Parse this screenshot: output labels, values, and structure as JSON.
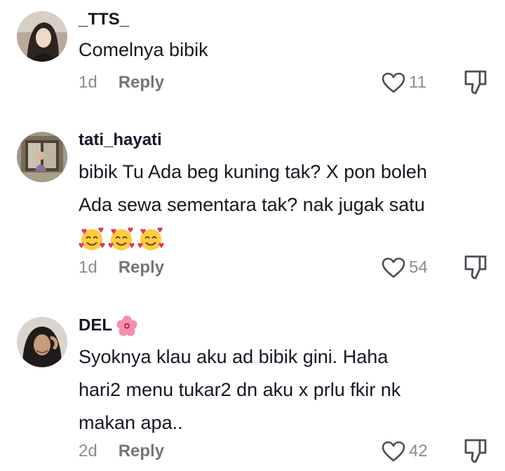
{
  "comments": [
    {
      "username": "_TTS_",
      "lines": [
        "Comelnya bibik"
      ],
      "time": "1d",
      "reply_label": "Reply",
      "likes": "11"
    },
    {
      "username": "tati_hayati",
      "lines": [
        "bibik Tu Ada beg kuning tak? X pon boleh",
        "Ada sewa sementara tak? nak jugak satu"
      ],
      "emoji": [
        "smiling-face-with-hearts",
        "smiling-face-with-hearts",
        "smiling-face-with-hearts"
      ],
      "time": "1d",
      "reply_label": "Reply",
      "likes": "54"
    },
    {
      "username": "DEL",
      "username_emoji": "hibiscus",
      "lines": [
        "Syoknya klau aku ad bibik gini. Haha",
        "hari2 menu tukar2 dn aku x prlu fkir nk",
        "makan apa.."
      ],
      "time": "2d",
      "reply_label": "Reply",
      "likes": "42"
    }
  ],
  "colors": {
    "text_primary": "#161823",
    "text_secondary": "#8a8b91",
    "background": "#ffffff"
  }
}
